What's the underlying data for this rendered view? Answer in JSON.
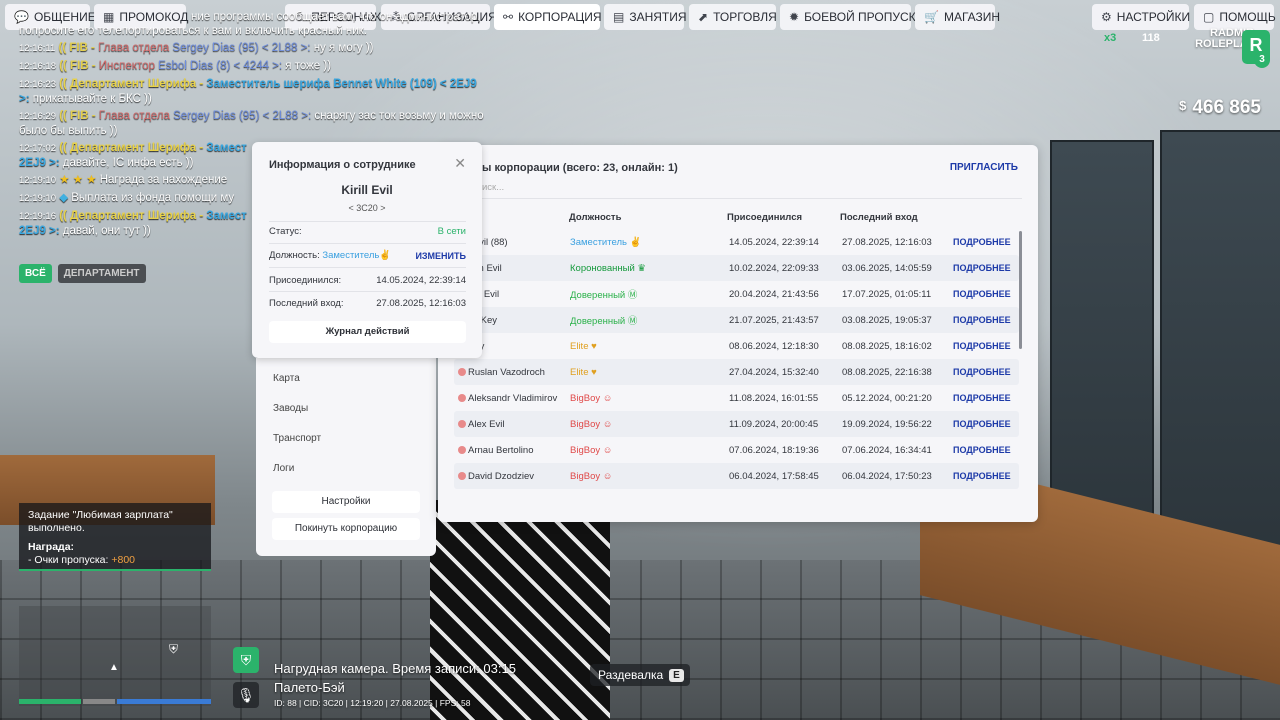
{
  "nav": {
    "left": [
      {
        "label": "ОБЩЕНИЕ",
        "icon": "chat-icon"
      },
      {
        "label": "ПРОМОКОД",
        "icon": "gift-icon"
      }
    ],
    "center": [
      {
        "label": "ПЕРСОНАЖ",
        "icon": "person-icon"
      },
      {
        "label": "ОРГАНИЗАЦИЯ",
        "icon": "org-icon"
      },
      {
        "label": "КОРПОРАЦИЯ",
        "icon": "handshake-icon",
        "active": true
      },
      {
        "label": "ЗАНЯТИЯ",
        "icon": "calendar-icon"
      },
      {
        "label": "ТОРГОВЛЯ",
        "icon": "chart-icon"
      },
      {
        "label": "БОЕВОЙ ПРОПУСК",
        "icon": "gear-badge-icon"
      },
      {
        "label": "МАГАЗИН",
        "icon": "cart-icon"
      }
    ],
    "right": [
      {
        "label": "НАСТРОЙКИ",
        "icon": "gear-icon"
      },
      {
        "label": "ПОМОЩЬ",
        "icon": "help-icon"
      }
    ]
  },
  "hud": {
    "money_currency": "$",
    "money": "466 865",
    "badge_x": "x3",
    "online": "118",
    "logo_line1": "RADMIR",
    "logo_line2": "ROLEPLAY",
    "logo_mark": "R",
    "logo_num": "3"
  },
  "chat": {
    "line0": "ние программы сообщает вам, что он администратор, попросите его телепортироваться к вам и включить красный ник.",
    "lines": [
      {
        "time": "12:16:11",
        "org": "(( FIB -",
        "rank": " Глава отдела ",
        "name": "Sergey Dias (95) < 2L88 >:",
        "text": " ну я могу ))"
      },
      {
        "time": "12:16:18",
        "org": "(( FIB -",
        "rank": " Инспектор ",
        "name": "Esbol Dias (8) < 4244 >:",
        "text": " я тоже ))"
      },
      {
        "time": "12:16:23",
        "org": "(( Департамент Шерифа -",
        "rank": " Заместитель шерифа ",
        "name": "Bennet White (109) < 2EJ9 >:",
        "text": " прикатывайте к БКС ))"
      },
      {
        "time": "12:16:29",
        "org": "(( FIB -",
        "rank": " Глава отдела ",
        "name": "Sergey Dias (95) < 2L88 >:",
        "text": " снарягу зас ток возьму и можно было бы выпить ))"
      },
      {
        "time": "12:17:02",
        "org": "(( Департамент Шерифа -",
        "rank": " Замест",
        "name": "2EJ9 >:",
        "text": " давайте, IC инфа есть ))"
      },
      {
        "time": "12:19:10",
        "org": "★ ★ ★",
        "rank": "",
        "name": "",
        "text": " Награда за нахождение"
      },
      {
        "time": "12:19:10",
        "org": "◆",
        "rank": "",
        "name": "",
        "text": " Выплата из фонда помощи му"
      },
      {
        "time": "12:19:16",
        "org": "(( Департамент Шерифа -",
        "rank": " Замест",
        "name": "2EJ9 >:",
        "text": " давай, они тут ))"
      }
    ],
    "tab_all": "ВСЁ",
    "tab_dept": "ДЕПАРТАМЕНТ"
  },
  "card": {
    "title": "Информация о сотруднике",
    "name": "Kirill Evil",
    "tag": "< 3C20 >",
    "status_label": "Статус:",
    "status_value": "В сети",
    "position_label": "Должность:",
    "position_value": "Заместитель",
    "change_label": "ИЗМЕНИТЬ",
    "joined_label": "Присоединился:",
    "joined_value": "14.05.2024, 22:39:14",
    "last_label": "Последний вход:",
    "last_value": "27.08.2025, 12:16:03",
    "journal": "Журнал действий"
  },
  "side": {
    "items": [
      "Карта",
      "Заводы",
      "Транспорт",
      "Логи"
    ],
    "settings": "Настройки",
    "leave": "Покинуть корпорацию"
  },
  "panel": {
    "title": "ы корпорации (всего: 23, онлайн: 1)",
    "invite": "ПРИГЛАСИТЬ",
    "search_placeholder": "иск...",
    "col_position": "Должность",
    "col_joined": "Присоединился",
    "col_last": "Последний вход",
    "more_label": "ПОДРОБНЕЕ",
    "rows": [
      {
        "name": "l Evil (88)",
        "pos": "Заместитель",
        "pos_color": "#3aa0e0",
        "emoji": "✌",
        "join": "14.05.2024, 22:39:14",
        "last": "27.08.2025, 12:16:03",
        "online": false
      },
      {
        "name": "mm Evil",
        "pos": "Коронованный",
        "pos_color": "#159a3c",
        "emoji": "♛",
        "join": "10.02.2024, 22:09:33",
        "last": "03.06.2025, 14:05:59",
        "online": false
      },
      {
        "name": "em Evil",
        "pos": "Доверенный",
        "pos_color": "#2bb14a",
        "emoji": "Ⓜ",
        "join": "20.04.2024, 21:43:56",
        "last": "17.07.2025, 01:05:11",
        "online": false
      },
      {
        "name": "ya Key",
        "pos": "Доверенный",
        "pos_color": "#2bb14a",
        "emoji": "Ⓜ",
        "join": "21.07.2025, 21:43:57",
        "last": "03.08.2025, 19:05:37",
        "online": false
      },
      {
        "name": "Sey",
        "pos": "Elite",
        "pos_color": "#e0a020",
        "emoji": "♥",
        "join": "08.06.2024, 12:18:30",
        "last": "08.08.2025, 18:16:02",
        "online": false
      },
      {
        "name": "Ruslan Vazodroch",
        "pos": "Elite",
        "pos_color": "#e0a020",
        "emoji": "♥",
        "join": "27.04.2024, 15:32:40",
        "last": "08.08.2025, 22:16:38",
        "online": true
      },
      {
        "name": "Aleksandr Vladimirov",
        "pos": "BigBoy",
        "pos_color": "#e04a4a",
        "emoji": "☺",
        "join": "11.08.2024, 16:01:55",
        "last": "05.12.2024, 00:21:20",
        "online": true
      },
      {
        "name": "Alex Evil",
        "pos": "BigBoy",
        "pos_color": "#e04a4a",
        "emoji": "☺",
        "join": "11.09.2024, 20:00:45",
        "last": "19.09.2024, 19:56:22",
        "online": true
      },
      {
        "name": "Arnau Bertolino",
        "pos": "BigBoy",
        "pos_color": "#e04a4a",
        "emoji": "☺",
        "join": "07.06.2024, 18:19:36",
        "last": "07.06.2024, 16:34:41",
        "online": true
      },
      {
        "name": "David Dzodziev",
        "pos": "BigBoy",
        "pos_color": "#e04a4a",
        "emoji": "☺",
        "join": "06.04.2024, 17:58:45",
        "last": "06.04.2024, 17:50:23",
        "online": true
      }
    ]
  },
  "task": {
    "line1": "Задание \"Любимая зарплата\"",
    "line2": "выполнено.",
    "reward_label": "Награда:",
    "reward_text": "- Очки пропуска:",
    "reward_value": "+800"
  },
  "bottom": {
    "cam": "Нагрудная камера. Время записи: 03:15",
    "location": "Палето-Бэй",
    "ids": "ID: 88 | CID: 3C20 | 12:19:20  | 27.08.2025 | FPS: 58",
    "dress_label": "Раздевалка",
    "dress_key": "E"
  },
  "colors": {
    "accent_blue": "#1d3aa8",
    "online_green": "#2bb36b",
    "offline_dot": "#e88a8a"
  }
}
